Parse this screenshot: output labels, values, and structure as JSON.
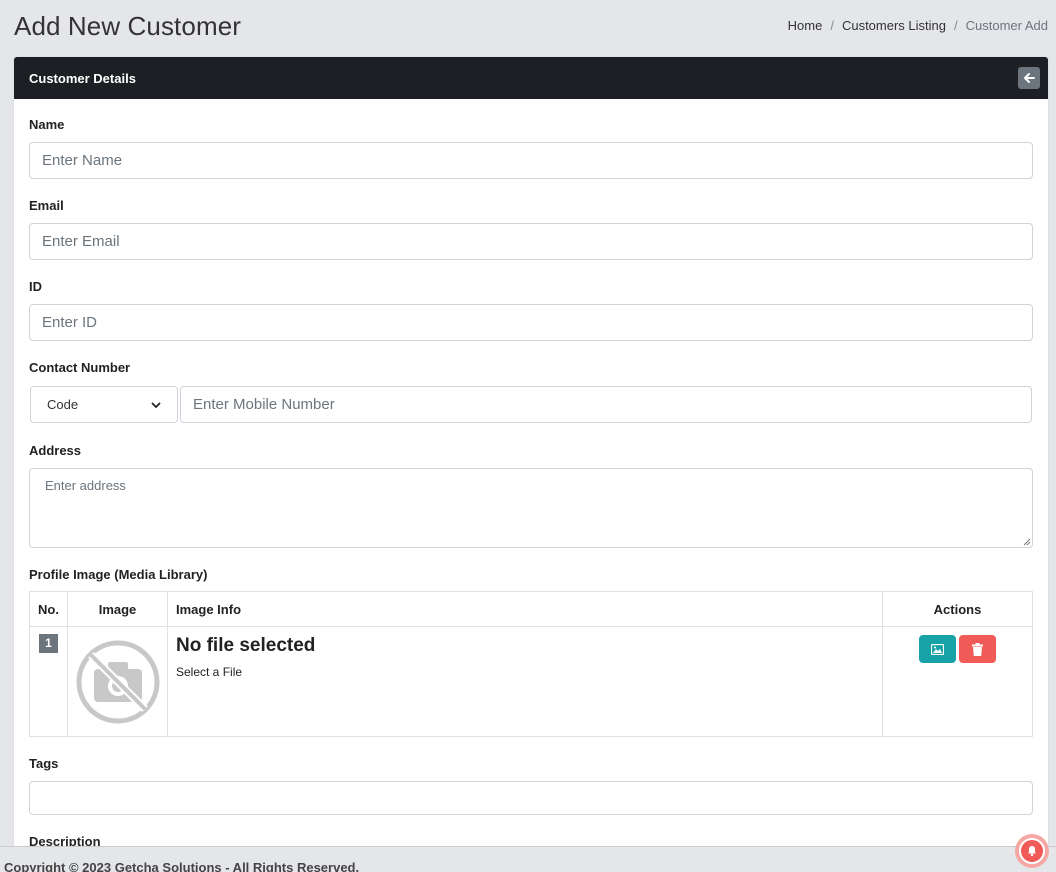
{
  "page": {
    "title": "Add New Customer"
  },
  "breadcrumb": {
    "items": [
      "Home",
      "Customers Listing"
    ],
    "separator": "/",
    "active": "Customer Add"
  },
  "card": {
    "title": "Customer Details",
    "back_icon": "arrow-left-icon"
  },
  "form": {
    "name": {
      "label": "Name",
      "placeholder": "Enter Name",
      "value": ""
    },
    "email": {
      "label": "Email",
      "placeholder": "Enter Email",
      "value": ""
    },
    "id": {
      "label": "ID",
      "placeholder": "Enter ID",
      "value": ""
    },
    "contact": {
      "label": "Contact Number",
      "code_selected": "Code",
      "placeholder": "Enter Mobile Number",
      "value": ""
    },
    "address": {
      "label": "Address",
      "placeholder": "Enter address",
      "value": ""
    },
    "profile_image": {
      "label": "Profile Image (Media Library)",
      "columns": [
        "No.",
        "Image",
        "Image Info",
        "Actions"
      ],
      "rows": [
        {
          "no": "1",
          "info_title": "No file selected",
          "info_sub": "Select a File"
        }
      ]
    },
    "tags": {
      "label": "Tags",
      "value": ""
    },
    "description": {
      "label": "Description"
    }
  },
  "footer": {
    "text": "Copyright © 2023 Getcha Solutions - All Rights Reserved."
  },
  "colors": {
    "header_bg": "#1c1f23",
    "image_button": "#17a2a8",
    "delete_button": "#f05a57",
    "badge": "#6c757d"
  }
}
